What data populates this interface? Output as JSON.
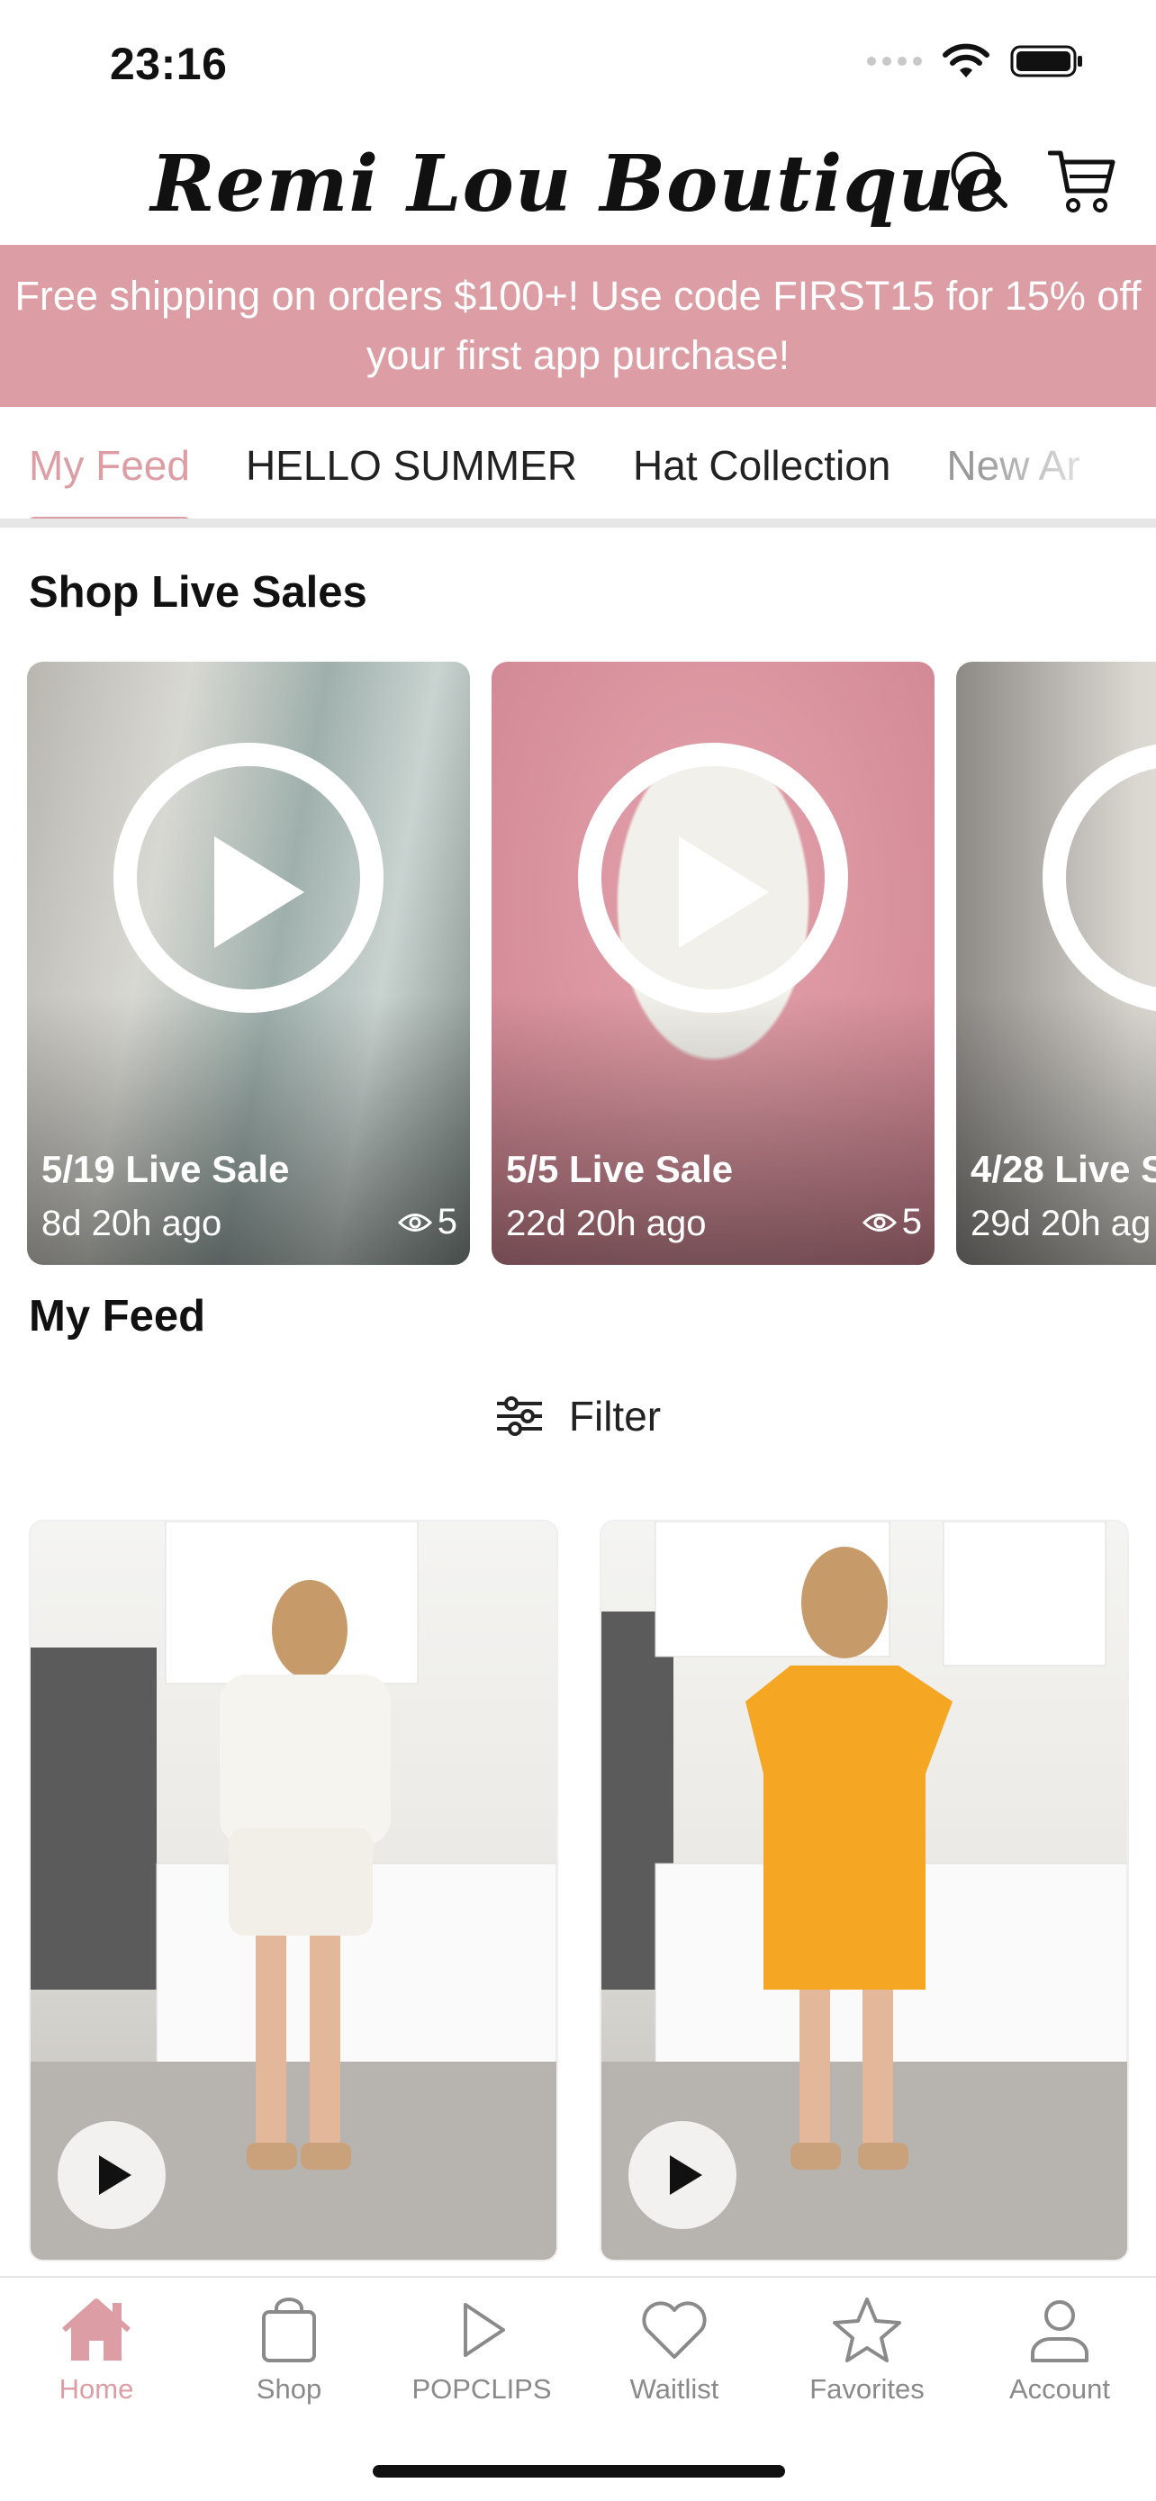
{
  "status_bar": {
    "time": "23:16"
  },
  "header": {
    "brand": "Remi Lou Boutique"
  },
  "promo_banner": {
    "text": "Free shipping on orders $100+! Use code FIRST15 for 15% off your first app purchase!"
  },
  "tabs": [
    {
      "label": "My Feed",
      "active": true
    },
    {
      "label": "HELLO SUMMER",
      "active": false
    },
    {
      "label": "Hat Collection",
      "active": false
    },
    {
      "label": "New Ar",
      "active": false
    }
  ],
  "live_sales": {
    "title": "Shop Live Sales",
    "cards": [
      {
        "title": "5/19 Live Sale",
        "ago": "8d 20h ago",
        "views": "5"
      },
      {
        "title": "5/5 Live Sale",
        "ago": "22d 20h ago",
        "views": "5"
      },
      {
        "title": "4/28 Live S",
        "ago": "29d 20h ag",
        "views": ""
      }
    ]
  },
  "feed": {
    "title": "My Feed",
    "filter_label": "Filter"
  },
  "bottom_nav": [
    {
      "label": "Home",
      "icon": "home-icon",
      "active": true
    },
    {
      "label": "Shop",
      "icon": "bag-icon",
      "active": false
    },
    {
      "label": "POPCLIPS",
      "icon": "play-outline-icon",
      "active": false
    },
    {
      "label": "Waitlist",
      "icon": "heart-icon",
      "active": false
    },
    {
      "label": "Favorites",
      "icon": "star-icon",
      "active": false
    },
    {
      "label": "Account",
      "icon": "person-icon",
      "active": false
    }
  ],
  "colors": {
    "accent": "#dc9ea4",
    "text": "#111111",
    "muted": "#8a8a8a"
  }
}
